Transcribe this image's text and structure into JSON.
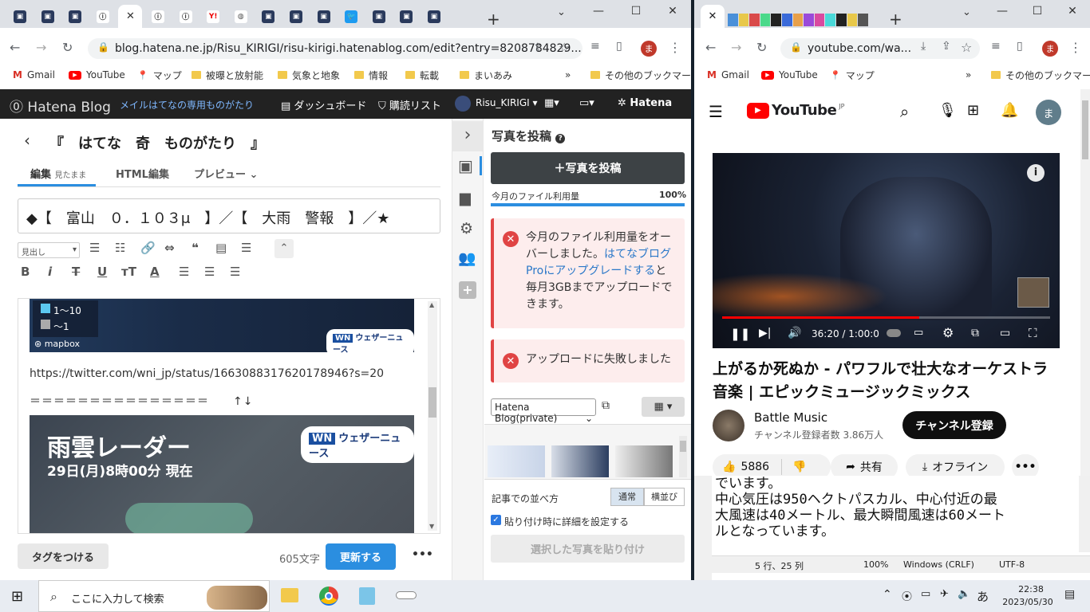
{
  "left_browser": {
    "tab_favicons": [
      "hatena",
      "hatena",
      "hatena",
      "info",
      "hatena",
      "info",
      "info",
      "yahoo",
      "globe",
      "hatena",
      "hatena",
      "hatena",
      "twitter",
      "hatena",
      "hatena",
      "hatena"
    ],
    "address": "blog.hatena.ne.jp/Risu_KIRIGI/risu-kirigi.hatenablog.com/edit?entry=8208784829...",
    "bookmarks": [
      "Gmail",
      "YouTube",
      "マップ",
      "被曝と放射能",
      "気象と地象",
      "情報",
      "転載",
      "まいあみ"
    ],
    "other_bookmarks": "その他のブックマーク",
    "profile_initial": "ま"
  },
  "hatena_bar": {
    "logo": "Hatena Blog",
    "marquee": "メイルはてなの専用ものがたり",
    "dashboard": "ダッシュボード",
    "reading_list": "購読リスト",
    "user": "Risu_KIRIGI",
    "brand": "Hatena"
  },
  "editor": {
    "blog_title": "『　はてな　奇　ものがたり　』",
    "tabs": {
      "edit": "編集",
      "edit_sub": "見たまま",
      "html": "HTML編集",
      "preview": "プレビュー"
    },
    "post_title": "◆【　富山　０．１０３μ　】／【　大雨　警報　】／★",
    "heading_select": "見出し",
    "legend": [
      "1〜10",
      "〜1"
    ],
    "mapbox": "mapbox",
    "weathernews": "ウェザーニュース",
    "url_line": "https://twitter.com/wni_jp/status/1663088317620178946?s=20",
    "separator": "＝＝＝＝＝＝＝＝＝＝＝＝＝＝＝",
    "radar_title": "雨雲レーダー",
    "radar_time": "29日(月)8時00分 現在",
    "tag_button": "タグをつける",
    "char_count": "605文字",
    "update_button": "更新する",
    "more": "•••"
  },
  "photo_panel": {
    "heading": "写真を投稿",
    "post_button": "写真を投稿",
    "usage_label": "今月のファイル利用量",
    "usage_percent": "100%",
    "usage_fraction": 1.0,
    "error1_prefix": "今月のファイル利用量をオーバーしました。",
    "error1_link": "はてなブログProにアップグレードする",
    "error1_suffix": "と毎月3GBまでアップロードできます。",
    "error2": "アップロードに失敗しました",
    "album_select": "Hatena Blog(private)",
    "sort_label": "記事での並べ方",
    "sort_normal": "通常",
    "sort_side": "横並び",
    "detail_checkbox": "貼り付け時に詳細を設定する",
    "paste_button": "選択した写真を貼り付け"
  },
  "right_browser": {
    "address": "youtube.com/wa...",
    "bookmarks": [
      "Gmail",
      "YouTube",
      "マップ"
    ],
    "other_bookmarks": "その他のブックマーク",
    "profile_initial": "ま"
  },
  "youtube": {
    "logo": "YouTube",
    "region": "JP",
    "avatar": "ま",
    "time": "36:20 / 1:00:0",
    "progress_fraction": 0.6,
    "video_title": "上がるか死ぬか - パワフルで壮大なオーケストラ音楽 | エピックミュージックミックス",
    "channel": "Battle Music",
    "subscribers": "チャンネル登録者数 3.86万人",
    "subscribe": "チャンネル登録",
    "likes": "5886",
    "share": "共有",
    "offline": "オフライン",
    "more": "•••"
  },
  "notepad": {
    "line1": "でいます。",
    "line2": "中心気圧は950ヘクトパスカル、中心付近の最",
    "line3": "大風速は40メートル、最大瞬間風速は60メート",
    "line4": "ルとなっています。",
    "status_pos": "5 行、25 列",
    "zoom": "100%",
    "eol": "Windows (CRLF)",
    "encoding": "UTF-8"
  },
  "taskbar": {
    "search_placeholder": "ここに入力して検索",
    "time": "22:38",
    "date": "2023/05/30",
    "ime": "あ"
  }
}
